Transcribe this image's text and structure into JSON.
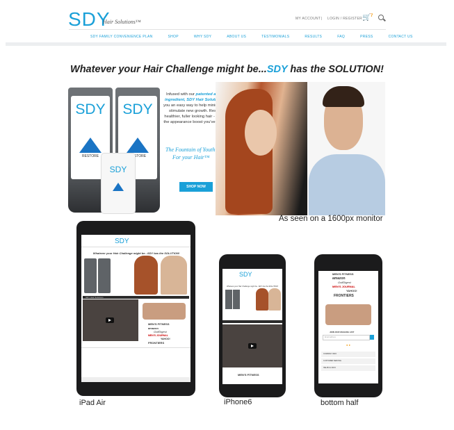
{
  "header": {
    "logo": "SDY",
    "logo_sub": "Hair Solutions™",
    "my_account": "MY ACCOUNT",
    "separator": "|",
    "login": "LOGIN / REGISTER",
    "cart_count": "7",
    "nav": [
      "SDY FAMILY CONVENIENCE PLAN",
      "SHOP",
      "WHY SDY",
      "ABOUT US",
      "TESTIMONIALS",
      "RESULTS",
      "FAQ",
      "PRESS",
      "CONTACT US"
    ]
  },
  "headline": {
    "pre": "Whatever your Hair Challenge might be...",
    "brand": "SDY",
    "post": " has the SOLUTION!"
  },
  "hero": {
    "tube_brand": "SDY",
    "tube_label": "RESTORE",
    "bottle_brand": "SDY",
    "copy_a": "Infused with our ",
    "copy_b": "patented anti-aging ingredient,",
    "copy_c": " SDY Hair Solutions",
    "copy_d": " offers you an easy way to help minimize loss & stimulate new growth. Resulting in healthier, fuller looking hair - giving ",
    "copy_e": "you",
    "copy_f": " the appearance boost you've longed for!",
    "fountain_1": "The Fountain of Youth",
    "fountain_2": "For your Hair™",
    "shop_now": "SHOP NOW"
  },
  "seen_label": "As seen on a 1600px monitor",
  "ipad": {
    "logo": "SDY",
    "headline": "Whatever your Hair Challenge might be...SDY has the SOLUTION!",
    "video_title": "SDY Hair Solutions",
    "press": [
      "MEN'S FITNESS",
      "amazon",
      "GolfDigest",
      "MEN'S JOURNAL",
      "YAHOO!",
      "FRONTIERS"
    ],
    "caption": "iPad Air"
  },
  "iphone": {
    "logo": "SDY",
    "headline": "Whatever your Hair Challenge might be...SDY has the SOLUTION!",
    "press": "MEN'S FITNESS",
    "caption": "iPhone6"
  },
  "bottom": {
    "press": [
      "MEN'S FITNESS",
      "amazon",
      "GolfDigest",
      "MEN'S JOURNAL",
      "YAHOO!",
      "FRONTIERS"
    ],
    "join": "JOIN OUR MAILING LIST",
    "email_placeholder": "Email address",
    "rows": [
      "COMPANY INFO",
      "CUSTOMER SERVICE",
      "HELPFUL INFO"
    ],
    "caption": "bottom half"
  }
}
